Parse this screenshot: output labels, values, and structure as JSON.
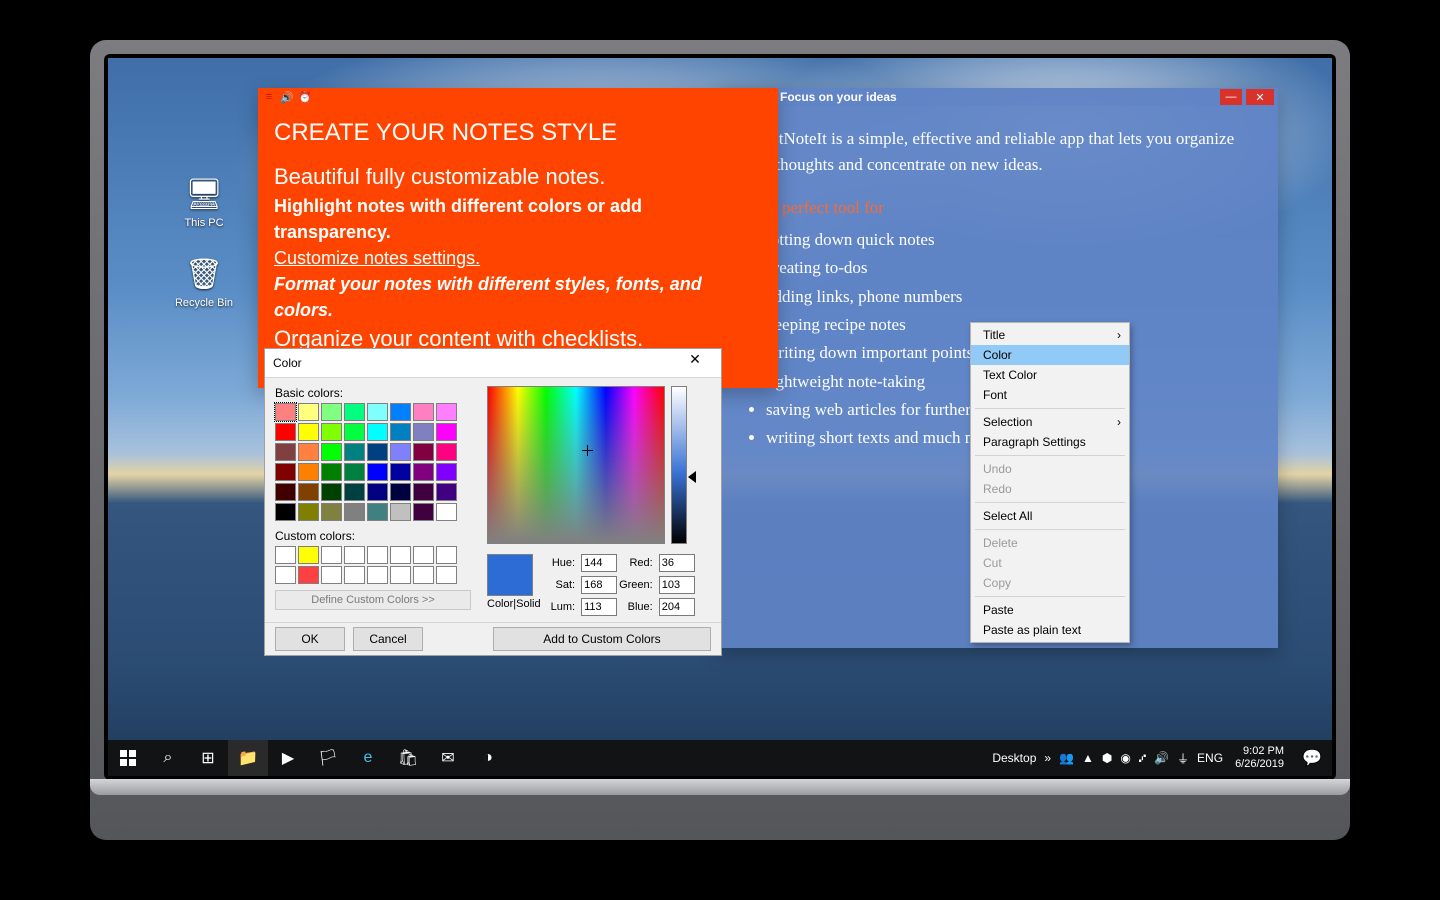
{
  "desktop": {
    "icons": [
      {
        "name": "this-pc",
        "label": "This PC",
        "glyph": "🖥"
      },
      {
        "name": "recycle-bin",
        "label": "Recycle Bin",
        "glyph": "🗑"
      }
    ]
  },
  "note_orange": {
    "heading": "CREATE YOUR NOTES STYLE",
    "line1": "Beautiful fully customizable notes.",
    "line2": "Highlight notes with different colors or add transparency.",
    "line3": "Customize notes settings.",
    "line4": "Format your notes with different styles, fonts, and colors.",
    "line5": "Organize your content with checklists."
  },
  "note_blue": {
    "title": "Focus on your ideas",
    "intro": "    JustNoteIt is a simple, effective and reliable app that lets you organize your thoughts and concentrate on new ideas.",
    "lead": "It is a perfect tool for",
    "bullets": [
      "jotting down quick notes",
      "creating to-dos",
      "adding links, phone numbers",
      "keeping recipe notes",
      "writing down important points for meetings",
      "lightweight note-taking",
      "saving web articles for further reading",
      "writing short texts and much more"
    ]
  },
  "color_dialog": {
    "title": "Color",
    "basic_label": "Basic colors:",
    "custom_label": "Custom colors:",
    "define_btn": "Define Custom Colors >>",
    "ok": "OK",
    "cancel": "Cancel",
    "add": "Add to Custom Colors",
    "colorsolid": "Color|Solid",
    "fields": {
      "hue_label": "Hue:",
      "hue": "144",
      "sat_label": "Sat:",
      "sat": "168",
      "lum_label": "Lum:",
      "lum": "113",
      "red_label": "Red:",
      "red": "36",
      "green_label": "Green:",
      "green": "103",
      "blue_label": "Blue:",
      "blue": "204"
    },
    "basic_colors": [
      "#ff8080",
      "#ffff80",
      "#80ff80",
      "#00ff80",
      "#80ffff",
      "#0080ff",
      "#ff80c0",
      "#ff80ff",
      "#ff0000",
      "#ffff00",
      "#80ff00",
      "#00ff40",
      "#00ffff",
      "#0080c0",
      "#8080c0",
      "#ff00ff",
      "#804040",
      "#ff8040",
      "#00ff00",
      "#008080",
      "#004080",
      "#8080ff",
      "#800040",
      "#ff0080",
      "#800000",
      "#ff8000",
      "#008000",
      "#008040",
      "#0000ff",
      "#0000a0",
      "#800080",
      "#8000ff",
      "#400000",
      "#804000",
      "#004000",
      "#004040",
      "#000080",
      "#000040",
      "#400040",
      "#400080",
      "#000000",
      "#808000",
      "#808040",
      "#808080",
      "#408080",
      "#c0c0c0",
      "#400040",
      "#ffffff"
    ],
    "custom_colors": [
      "#ffffff",
      "#ffff00",
      "#ffffff",
      "#ffffff",
      "#ffffff",
      "#ffffff",
      "#ffffff",
      "#ffffff",
      "#ffffff",
      "#ff4040",
      "#ffffff",
      "#ffffff",
      "#ffffff",
      "#ffffff",
      "#ffffff",
      "#ffffff"
    ]
  },
  "context_menu": {
    "items": [
      {
        "label": "Title",
        "submenu": true
      },
      {
        "label": "Color",
        "selected": true
      },
      {
        "label": "Text Color"
      },
      {
        "label": "Font"
      },
      {
        "sep": true
      },
      {
        "label": "Selection",
        "submenu": true
      },
      {
        "label": "Paragraph Settings"
      },
      {
        "sep": true
      },
      {
        "label": "Undo",
        "disabled": true
      },
      {
        "label": "Redo",
        "disabled": true
      },
      {
        "sep": true
      },
      {
        "label": "Select All"
      },
      {
        "sep": true
      },
      {
        "label": "Delete",
        "disabled": true
      },
      {
        "label": "Cut",
        "disabled": true
      },
      {
        "label": "Copy",
        "disabled": true
      },
      {
        "sep": true
      },
      {
        "label": "Paste"
      },
      {
        "label": "Paste as plain text"
      }
    ]
  },
  "taskbar": {
    "desktop_label": "Desktop",
    "lang": "ENG",
    "time": "9:02 PM",
    "date": "6/26/2019"
  }
}
